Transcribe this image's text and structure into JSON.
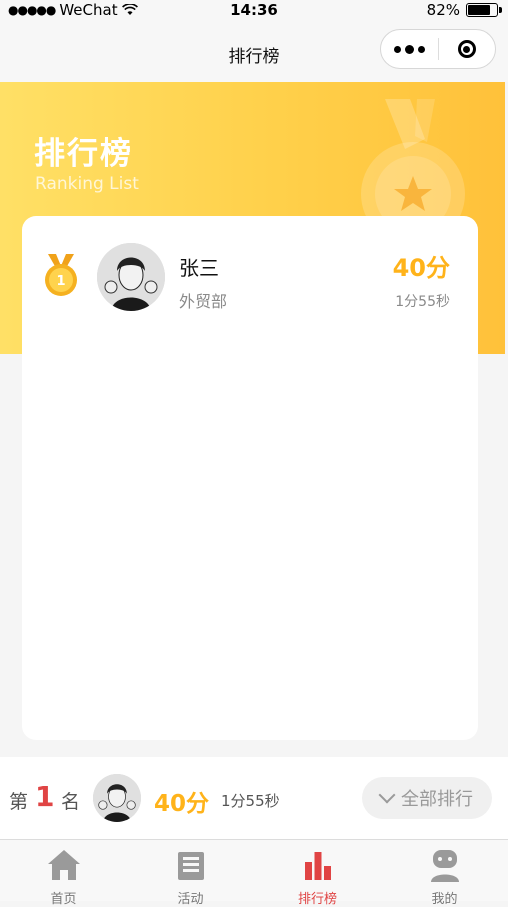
{
  "status_bar": {
    "carrier": "WeChat",
    "time": "14:36",
    "battery": "82%",
    "battery_level": 0.82
  },
  "nav": {
    "title": "排行榜"
  },
  "banner": {
    "title": "排行榜",
    "subtitle": "Ranking List"
  },
  "ranking": [
    {
      "rank": "1",
      "name": "张三",
      "department": "外贸部",
      "score": "40分",
      "time": "1分55秒"
    }
  ],
  "my_rank": {
    "prefix": "第",
    "rank": "1",
    "suffix": "名",
    "score": "40分",
    "time": "1分55秒",
    "button": "全部排行"
  },
  "tabs": [
    {
      "label": "首页",
      "icon": "home-icon"
    },
    {
      "label": "活动",
      "icon": "activity-icon"
    },
    {
      "label": "排行榜",
      "icon": "ranking-icon",
      "active": true
    },
    {
      "label": "我的",
      "icon": "profile-icon"
    }
  ],
  "colors": {
    "accent": "#ffb31a",
    "active_tab": "#e04444",
    "banner_start": "#ffe066",
    "banner_end": "#ffc13a"
  }
}
